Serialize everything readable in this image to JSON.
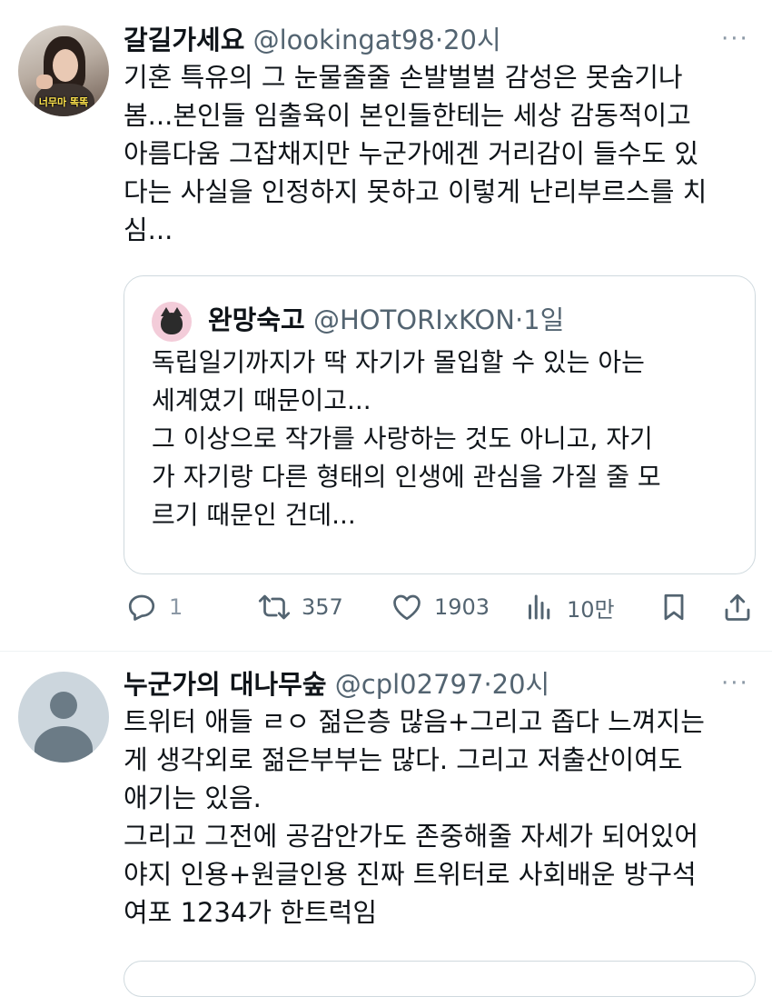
{
  "tweets": [
    {
      "name": "갈길가세요",
      "handle": "@lookingat98",
      "dot": "·",
      "time": "20시",
      "avatar_caption": "너무마 똑똑",
      "more": "···",
      "text": "기혼 특유의 그 눈물줄줄 손발벌벌 감성은 못숨기나\n봄...본인들 임출육이 본인들한테는 세상 감동적이고\n아름다움 그잡채지만 누군가에겐 거리감이 들수도 있\n다는 사실을 인정하지 못하고 이렇게 난리부르스를 치\n심...",
      "quote": {
        "name": "완망숙고",
        "handle": "@HOTORIxKON",
        "dot": "·",
        "time": "1일",
        "text": "독립일기까지가 딱 자기가 몰입할 수 있는 아는\n세계였기 때문이고...\n그 이상으로 작가를 사랑하는 것도 아니고, 자기\n가 자기랑 다른 형태의 인생에 관심을 가질 줄 모\n르기 때문인 건데..."
      },
      "actions": {
        "reply": "1",
        "retweet": "357",
        "like": "1903",
        "views": "10만"
      }
    },
    {
      "name": "누군가의 대나무숲",
      "handle": "@cpl02797",
      "dot": "·",
      "time": "20시",
      "more": "···",
      "text": "트위터 애들 ㄹㅇ 젊은층 많음+그리고 좁다 느껴지는\n게 생각외로 젊은부부는 많다. 그리고 저출산이여도\n애기는 있음.\n그리고 그전에 공감안가도 존중해줄 자세가 되어있어\n야지 인용+원글인용 진짜 트위터로 사회배운 방구석\n여포 1234가 한트럭임"
    }
  ],
  "colors": {
    "text": "#0f1419",
    "secondary": "#536471",
    "border": "#cfd9de",
    "divider": "#eff3f4"
  }
}
